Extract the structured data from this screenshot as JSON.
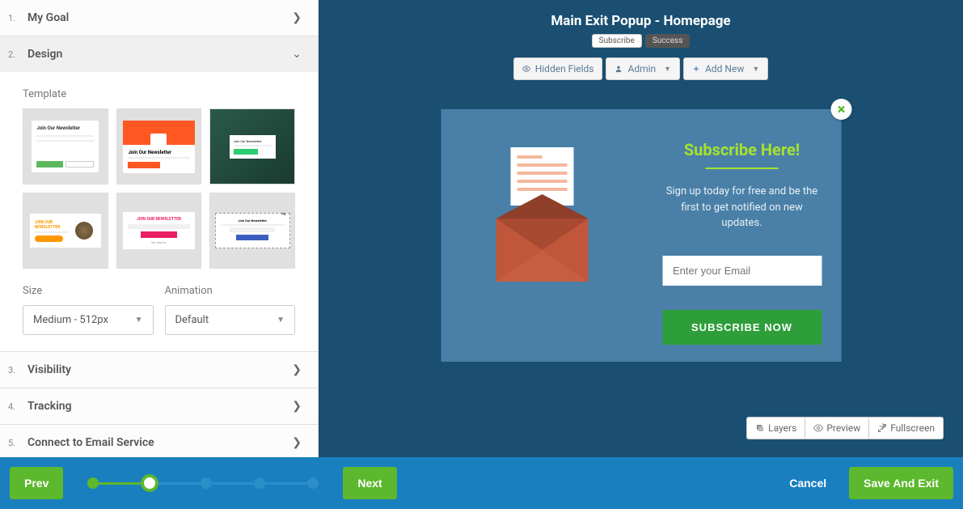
{
  "header": {
    "title": "Main Exit Popup - Homepage"
  },
  "tabs": {
    "subscribe": "Subscribe",
    "success": "Success"
  },
  "toolbar": {
    "hidden_fields": "Hidden Fields",
    "admin": "Admin",
    "add_new": "Add New"
  },
  "accordion": [
    {
      "num": "1.",
      "title": "My Goal"
    },
    {
      "num": "2.",
      "title": "Design"
    },
    {
      "num": "3.",
      "title": "Visibility"
    },
    {
      "num": "4.",
      "title": "Tracking"
    },
    {
      "num": "5.",
      "title": "Connect to Email Service"
    }
  ],
  "design": {
    "template_label": "Template",
    "size_label": "Size",
    "size_value": "Medium - 512px",
    "animation_label": "Animation",
    "animation_value": "Default"
  },
  "popup": {
    "heading": "Subscribe Here!",
    "desc": "Sign up today for free and be the first to get notified on new updates.",
    "email_placeholder": "Enter your Email",
    "cta": "SUBSCRIBE NOW"
  },
  "view_tools": {
    "layers": "Layers",
    "preview": "Preview",
    "fullscreen": "Fullscreen"
  },
  "footer": {
    "prev": "Prev",
    "next": "Next",
    "cancel": "Cancel",
    "save": "Save And Exit"
  },
  "colors": {
    "accent_green": "#5cb82c",
    "canvas_bg": "#1a4f72",
    "popup_bg": "#4a80a8",
    "cta_green": "#2e9e3b",
    "heading_lime": "#a6e22e"
  }
}
